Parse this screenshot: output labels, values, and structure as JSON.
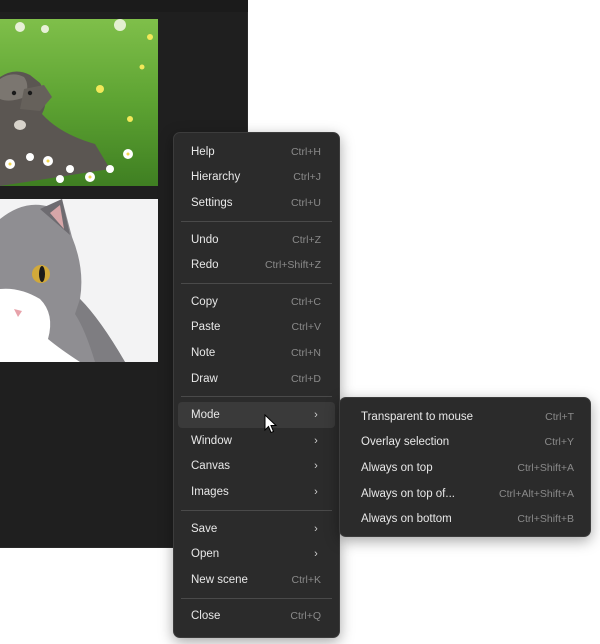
{
  "menu": {
    "items": [
      {
        "label": "Help",
        "shortcut": "Ctrl+H"
      },
      {
        "label": "Hierarchy",
        "shortcut": "Ctrl+J"
      },
      {
        "label": "Settings",
        "shortcut": "Ctrl+U"
      },
      {
        "label": "Undo",
        "shortcut": "Ctrl+Z"
      },
      {
        "label": "Redo",
        "shortcut": "Ctrl+Shift+Z"
      },
      {
        "label": "Copy",
        "shortcut": "Ctrl+C"
      },
      {
        "label": "Paste",
        "shortcut": "Ctrl+V"
      },
      {
        "label": "Note",
        "shortcut": "Ctrl+N"
      },
      {
        "label": "Draw",
        "shortcut": "Ctrl+D"
      },
      {
        "label": "Mode",
        "arrow": "›"
      },
      {
        "label": "Window",
        "arrow": "›"
      },
      {
        "label": "Canvas",
        "arrow": "›"
      },
      {
        "label": "Images",
        "arrow": "›"
      },
      {
        "label": "Save",
        "arrow": "›"
      },
      {
        "label": "Open",
        "arrow": "›"
      },
      {
        "label": "New scene",
        "shortcut": "Ctrl+K"
      },
      {
        "label": "Close",
        "shortcut": "Ctrl+Q"
      }
    ]
  },
  "submenu": {
    "items": [
      {
        "label": "Transparent to mouse",
        "shortcut": "Ctrl+T"
      },
      {
        "label": "Overlay selection",
        "shortcut": "Ctrl+Y"
      },
      {
        "label": "Always on top",
        "shortcut": "Ctrl+Shift+A"
      },
      {
        "label": "Always on top of...",
        "shortcut": "Ctrl+Alt+Shift+A"
      },
      {
        "label": "Always on bottom",
        "shortcut": "Ctrl+Shift+B"
      }
    ]
  },
  "colors": {
    "menu_bg": "#2b2b2b",
    "canvas_bg": "#1f1f1f",
    "highlight": "#3a3a3a",
    "shortcut_text": "#8a8a8a"
  }
}
